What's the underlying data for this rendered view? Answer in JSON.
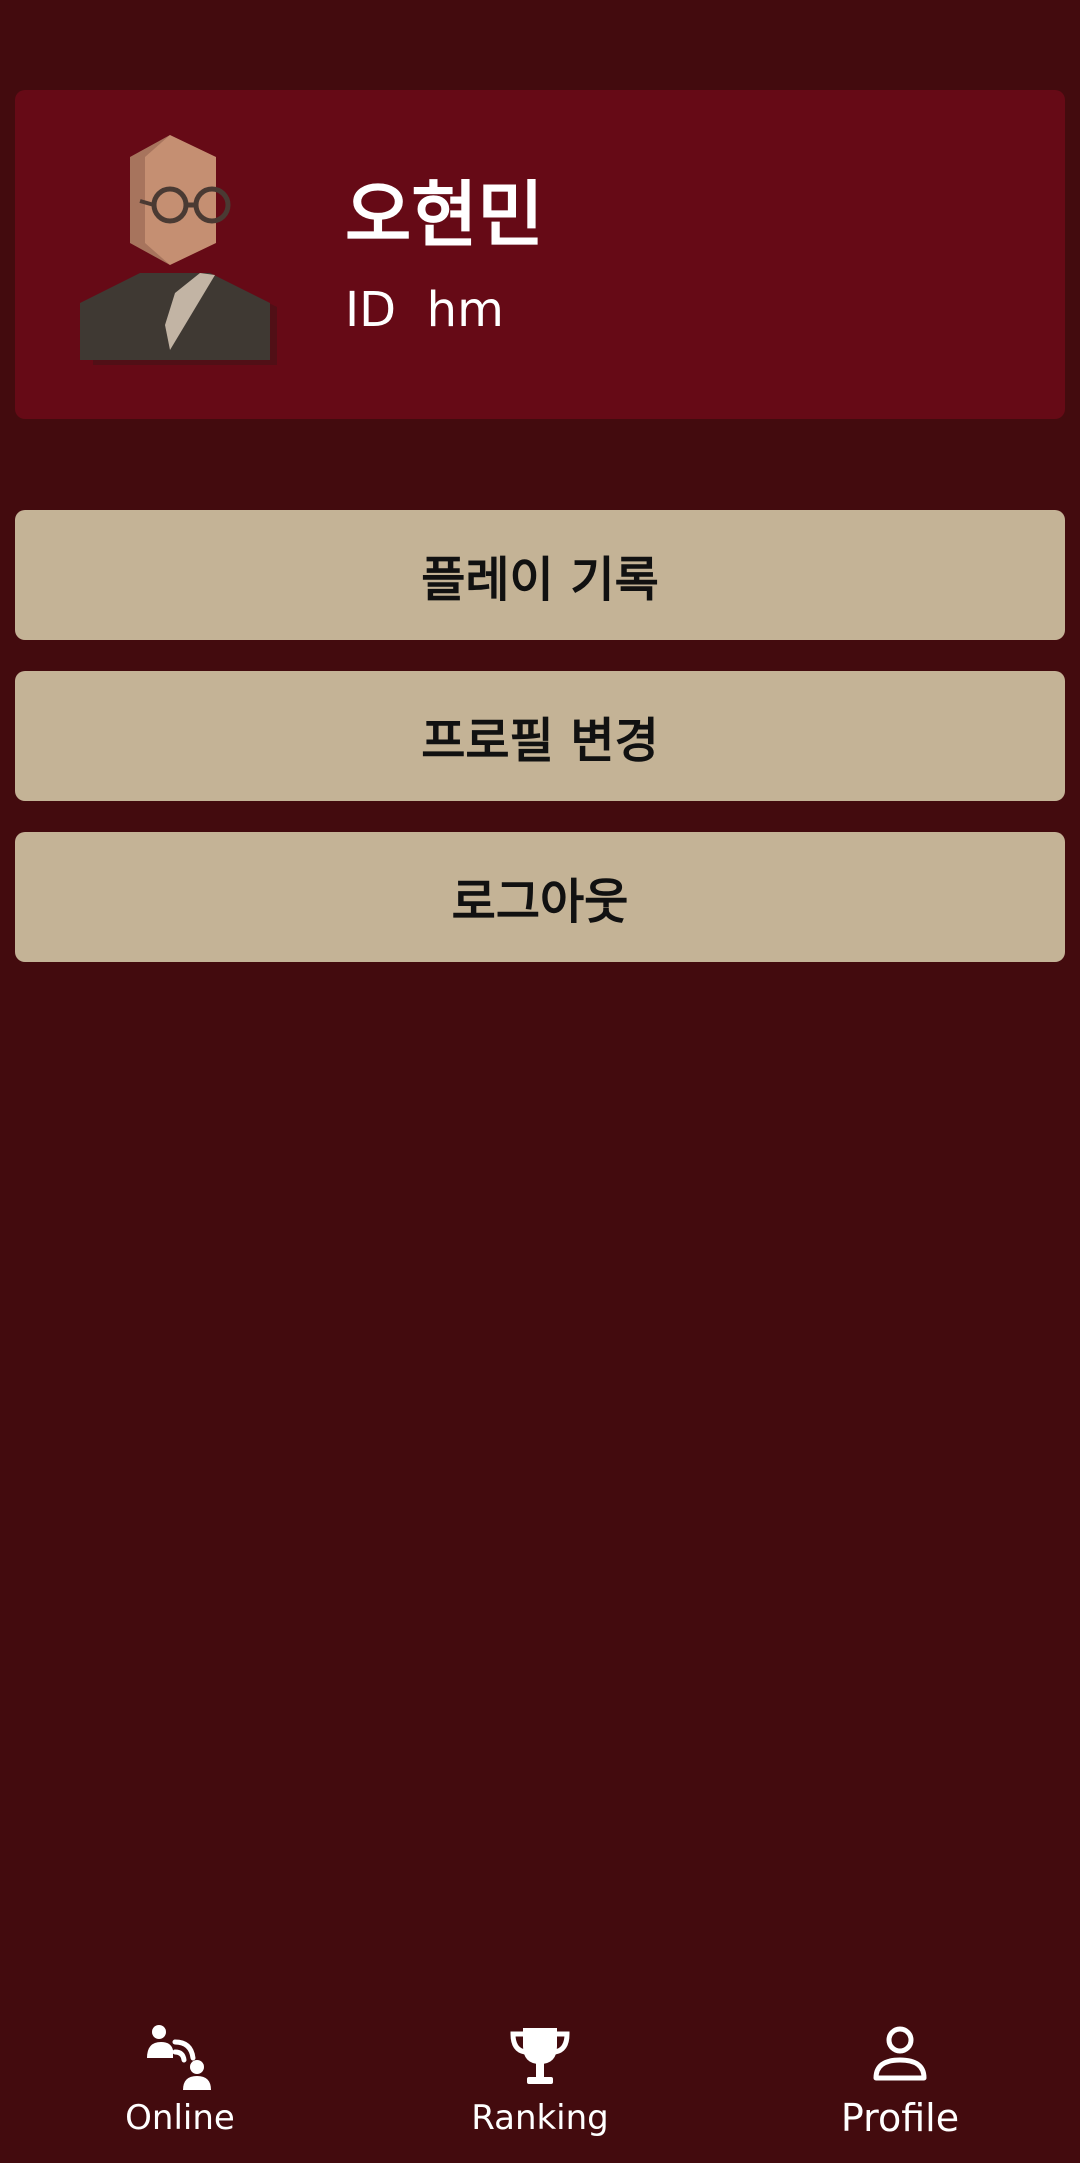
{
  "profile": {
    "name": "오현민",
    "id_label": "ID",
    "id_value": "hm",
    "avatar_icon": "person-with-glasses-avatar-icon"
  },
  "menu": {
    "play_history": "플레이 기록",
    "edit_profile": "프로필 변경",
    "logout": "로그아웃"
  },
  "nav": {
    "items": [
      {
        "label": "Online",
        "icon": "online-players-icon"
      },
      {
        "label": "Ranking",
        "icon": "trophy-icon"
      },
      {
        "label": "Profile",
        "icon": "person-icon",
        "active": true
      }
    ]
  },
  "colors": {
    "background": "#430b0e",
    "card": "#660a16",
    "button": "#c4b396",
    "text_light": "#ffffff",
    "text_dark": "#111111"
  }
}
